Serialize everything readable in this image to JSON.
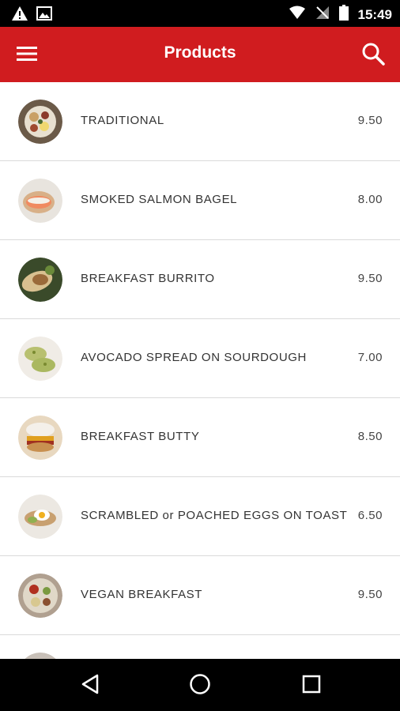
{
  "status_bar": {
    "time": "15:49",
    "icons": [
      "warning-icon",
      "image-icon",
      "wifi-icon",
      "no-signal-icon",
      "battery-icon"
    ]
  },
  "app_bar": {
    "title": "Products",
    "menu_icon": "hamburger-menu-icon",
    "search_icon": "search-icon",
    "background": "#d01c1f"
  },
  "products": [
    {
      "name": "TRADITIONAL",
      "price": "9.50"
    },
    {
      "name": "SMOKED SALMON BAGEL",
      "price": "8.00"
    },
    {
      "name": "BREAKFAST BURRITO",
      "price": "9.50"
    },
    {
      "name": "AVOCADO SPREAD ON SOURDOUGH",
      "price": "7.00"
    },
    {
      "name": "BREAKFAST BUTTY",
      "price": "8.50"
    },
    {
      "name": "SCRAMBLED or POACHED EGGS ON TOAST",
      "price": "6.50"
    },
    {
      "name": "VEGAN BREAKFAST",
      "price": "9.50"
    }
  ],
  "nav_bar": {
    "icons": [
      "back-icon",
      "home-icon",
      "recents-icon"
    ]
  }
}
